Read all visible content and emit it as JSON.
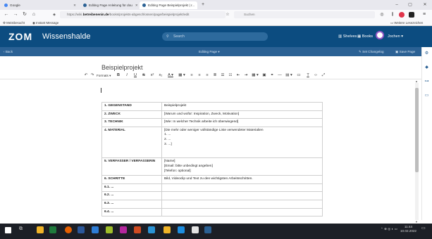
{
  "browser": {
    "tabs": [
      {
        "label": "Google",
        "active": false
      },
      {
        "label": "Editing Page Anleitung für dou",
        "active": false
      },
      {
        "label": "Editing Page Beispielprojekt | r...",
        "active": true
      }
    ],
    "new_tab": "+",
    "url_prefix": "https://wiki.",
    "url_domain": "betreibenenin.de",
    "url_path": "/books/projekts-abgeschlossen/page/beispielprojekt/edit",
    "search_placeholder": "Suchen",
    "bookmarks": [
      "Meistbesucht",
      "Instant Message"
    ],
    "other_bookmarks": "Weitere Lesezeichen"
  },
  "app": {
    "logo": "ZOM",
    "title": "Wissenshalde",
    "search_placeholder": "Search",
    "nav": {
      "shelves": "Shelves",
      "books": "Books",
      "user": "Jochen"
    },
    "colors": {
      "header": "#0c4c80",
      "actionbar": "#2b6194"
    }
  },
  "actions": {
    "back": "Back",
    "center": "Editing Page",
    "set_changelog": "Set Changelog",
    "save_page": "Save Page"
  },
  "editor": {
    "page_title": "Beispielprojekt",
    "formats_label": "Formats"
  },
  "table": {
    "rows": [
      {
        "key": "1. GEGENSTAND",
        "value": [
          "Beispielprojekt"
        ]
      },
      {
        "key": "2. ZWECK",
        "value": [
          "[Warum und wofür: Inspiration, Zweck, Motivation]"
        ]
      },
      {
        "key": "3. TECHNIK",
        "value": [
          "[Wie: In welcher Technik arbeite ich überwiegend]"
        ]
      },
      {
        "key": "4. MATERIAL",
        "value": [
          "[Die mehr oder weniger vollständige Liste verwendeter Materialien",
          "1. ...",
          "2. ...",
          "3. ...]",
          "",
          ""
        ]
      },
      {
        "key": "5. VERFASSER / VERFASSERIN",
        "value": [
          "[Name]",
          "[Email: bitte unbedingt angeben]",
          "[Telefon: optional]"
        ]
      },
      {
        "key": "6. SCHRITTE",
        "value": [
          "Bild, Videoclip und Text zu den wichtigsten Arbeitsschritten."
        ]
      },
      {
        "key": "6.1. ...",
        "value": [
          ""
        ]
      },
      {
        "key": "6.2. ...",
        "value": [
          ""
        ]
      },
      {
        "key": "6.3. ...",
        "value": [
          ""
        ]
      },
      {
        "key": "6.4. ...",
        "value": [
          ""
        ]
      }
    ]
  },
  "taskbar": {
    "time": "11:44",
    "date": "10.02.2022"
  }
}
